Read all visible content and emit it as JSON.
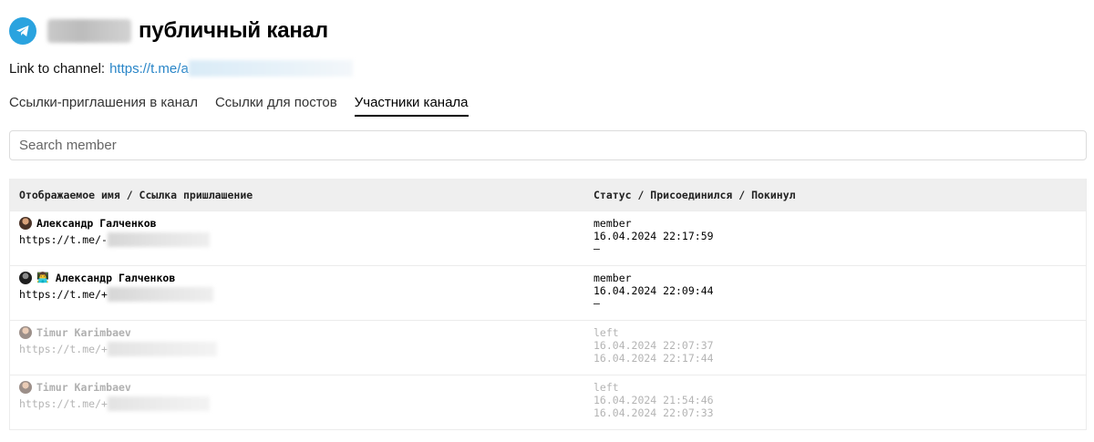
{
  "header": {
    "title": "публичный канал",
    "logo_icon": "telegram-icon"
  },
  "channel_link": {
    "label": "Link to channel:",
    "url_visible": "https://t.me/a"
  },
  "tabs": [
    {
      "label": "Ссылки-приглашения в канал",
      "active": false
    },
    {
      "label": "Ссылки для постов",
      "active": false
    },
    {
      "label": "Участники канала",
      "active": true
    }
  ],
  "search": {
    "placeholder": "Search member",
    "value": ""
  },
  "table": {
    "headers": [
      "Отображаемое имя / Ссылка пришлашение",
      "Статус / Присоединился / Покинул"
    ],
    "rows": [
      {
        "name": "Александр Галченков",
        "emoji": "",
        "link": "https://t.me/-",
        "status": "member",
        "joined": "16.04.2024 22:17:59",
        "left": "—",
        "dimmed": false
      },
      {
        "name": "Александр Галченков",
        "emoji": "👨‍💻",
        "link": "https://t.me/+",
        "status": "member",
        "joined": "16.04.2024 22:09:44",
        "left": "—",
        "dimmed": false
      },
      {
        "name": "Timur Karimbaev",
        "emoji": "",
        "link": "https://t.me/+",
        "status": "left",
        "joined": "16.04.2024 22:07:37",
        "left": "16.04.2024 22:17:44",
        "dimmed": true
      },
      {
        "name": "Timur Karimbaev",
        "emoji": "",
        "link": "https://t.me/+",
        "status": "left",
        "joined": "16.04.2024 21:54:46",
        "left": "16.04.2024 22:07:33",
        "dimmed": true
      }
    ]
  },
  "colors": {
    "telegram_blue": "#2aa3df",
    "link_blue": "#2a86c8",
    "header_bg": "#efefef"
  }
}
